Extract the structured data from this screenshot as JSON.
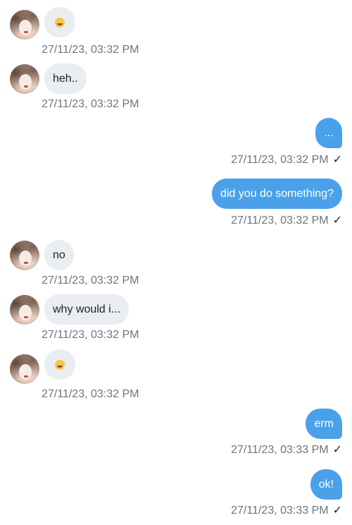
{
  "conversation": {
    "messages": [
      {
        "direction": "incoming",
        "text": "",
        "emoji": "face-with-hand-over-mouth-emoji",
        "timestamp": "27/11/23, 03:32 PM"
      },
      {
        "direction": "incoming",
        "text": "heh..",
        "timestamp": "27/11/23, 03:32 PM"
      },
      {
        "direction": "outgoing",
        "text": "...",
        "timestamp": "27/11/23, 03:32 PM",
        "status_mark": "✓"
      },
      {
        "direction": "outgoing",
        "text": "did you do something?",
        "timestamp": "27/11/23, 03:32 PM",
        "status_mark": "✓"
      },
      {
        "direction": "incoming",
        "text": "no",
        "timestamp": "27/11/23, 03:32 PM"
      },
      {
        "direction": "incoming",
        "text": "why would i...",
        "timestamp": "27/11/23, 03:32 PM"
      },
      {
        "direction": "incoming",
        "text": "",
        "emoji": "grimacing-face-emoji",
        "timestamp": "27/11/23, 03:32 PM"
      },
      {
        "direction": "outgoing",
        "text": "erm",
        "timestamp": "27/11/23, 03:33 PM",
        "status_mark": "✓"
      },
      {
        "direction": "outgoing",
        "text": "ok!",
        "timestamp": "27/11/23, 03:33 PM",
        "status_mark": "✓"
      }
    ]
  },
  "colors": {
    "incoming_bubble": "#eaedf1",
    "outgoing_bubble": "#4aa1ea",
    "timestamp_text": "#6b7580"
  }
}
